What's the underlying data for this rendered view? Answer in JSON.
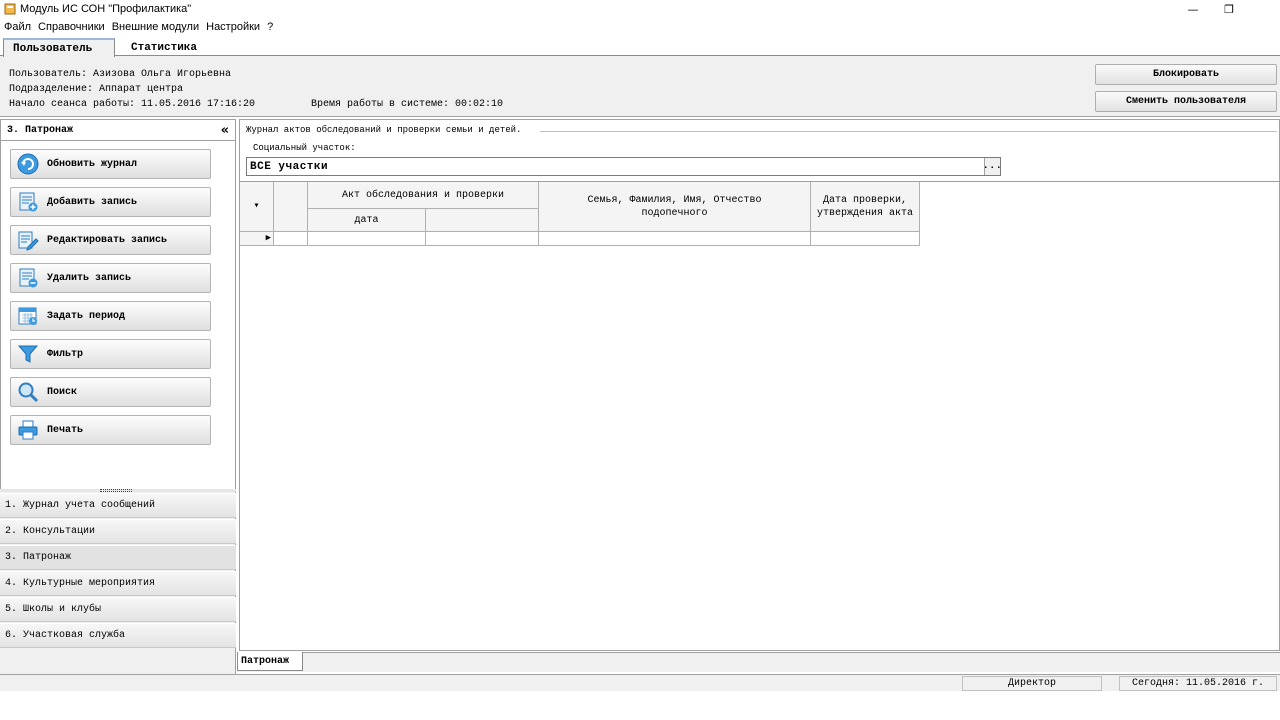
{
  "window": {
    "title": "Модуль ИС СОН \"Профилактика\"",
    "minimize_icon": "minimize-icon",
    "maximize_icon": "restore-icon",
    "minimize_glyph": "—",
    "restore_glyph": "❐"
  },
  "menu": {
    "items": [
      "Файл",
      "Справочники",
      "Внешние модули",
      "Настройки",
      "?"
    ]
  },
  "user_tabs": [
    "Пользователь",
    "Статистика"
  ],
  "user_info": {
    "user": "Пользователь: Азизова Ольга Игорьевна",
    "department": "Подразделение: Аппарат центра",
    "session_start": "Начало сеанса работы: 11.05.2016 17:16:20",
    "session_time": "Время работы в системе: 00:02:10",
    "block_button": "Блокировать",
    "switch_user_button": "Сменить пользователя"
  },
  "left_panel": {
    "header": "3. Патронаж",
    "collapse": "«",
    "actions": [
      {
        "label": "Обновить журнал",
        "icon": "refresh-icon"
      },
      {
        "label": "Добавить запись",
        "icon": "add-record-icon"
      },
      {
        "label": "Редактировать запись",
        "icon": "edit-record-icon"
      },
      {
        "label": "Удалить запись",
        "icon": "delete-record-icon"
      },
      {
        "label": "Задать период",
        "icon": "calendar-icon"
      },
      {
        "label": "Фильтр",
        "icon": "filter-icon"
      },
      {
        "label": "Поиск",
        "icon": "search-icon"
      },
      {
        "label": "Печать",
        "icon": "printer-icon"
      }
    ],
    "nav": [
      "1. Журнал учета сообщений",
      "2. Консультации",
      "3. Патронаж",
      "4. Культурные мероприятия",
      "5. Школы и клубы",
      "6. Участковая служба"
    ],
    "active_nav_index": 2
  },
  "main": {
    "group_label": "Журнал актов обследований и проверки семьи и детей.",
    "district_label": "Социальный участок:",
    "district_value": "ВСЕ участки",
    "district_button": "...",
    "grid": {
      "col_act": "Акт обследования и проверки",
      "col_act_date": "дата",
      "col_family": "Семья, Фамилия, Имя, Отчество подопечного",
      "col_check_date": "Дата проверки, утверждения акта",
      "sort_glyph": "▾",
      "row_pointer": "▶"
    }
  },
  "bottom_tab": "Патронаж",
  "statusbar": {
    "role": "Директор",
    "today": "Сегодня: 11.05.2016 г."
  },
  "colors": {
    "panel_bg": "#f0f0f0",
    "border": "#a0a0a0",
    "icon_blue": "#2f8fd8"
  }
}
